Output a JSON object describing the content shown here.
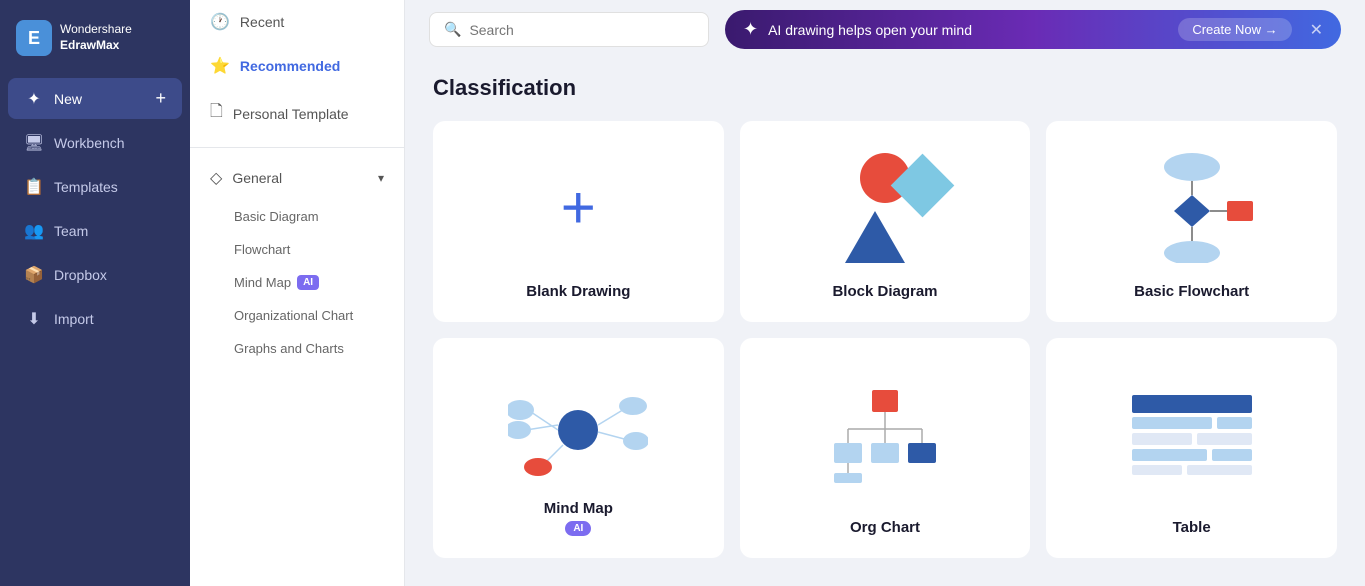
{
  "app": {
    "name": "Wondershare",
    "product": "EdrawMax"
  },
  "sidebar": {
    "items": [
      {
        "id": "new",
        "label": "New",
        "icon": "➕",
        "active": true
      },
      {
        "id": "workbench",
        "label": "Workbench",
        "icon": "🖥"
      },
      {
        "id": "templates",
        "label": "Templates",
        "icon": "📋"
      },
      {
        "id": "team",
        "label": "Team",
        "icon": "👥"
      },
      {
        "id": "dropbox",
        "label": "Dropbox",
        "icon": "📦"
      },
      {
        "id": "import",
        "label": "Import",
        "icon": "⬇"
      }
    ]
  },
  "nav": {
    "items": [
      {
        "id": "recent",
        "label": "Recent",
        "icon": "🕐"
      },
      {
        "id": "recommended",
        "label": "Recommended",
        "icon": "⭐",
        "active": true
      },
      {
        "id": "personal",
        "label": "Personal Template",
        "icon": "🖊"
      }
    ],
    "sections": [
      {
        "id": "general",
        "label": "General",
        "icon": "◇",
        "expanded": true,
        "sub": [
          {
            "id": "basic-diagram",
            "label": "Basic Diagram"
          },
          {
            "id": "flowchart",
            "label": "Flowchart"
          },
          {
            "id": "mind-map",
            "label": "Mind Map",
            "badge": "AI"
          },
          {
            "id": "org-chart",
            "label": "Organizational Chart"
          },
          {
            "id": "graphs",
            "label": "Graphs and Charts"
          }
        ]
      }
    ]
  },
  "topbar": {
    "search_placeholder": "Search",
    "ai_banner_text": "AI drawing helps open your mind",
    "ai_banner_btn": "Create Now →"
  },
  "main": {
    "section_title": "Classification",
    "cards": [
      {
        "id": "blank",
        "label": "Blank Drawing",
        "type": "blank"
      },
      {
        "id": "block",
        "label": "Block Diagram",
        "type": "block"
      },
      {
        "id": "flowchart",
        "label": "Basic Flowchart",
        "type": "flowchart"
      },
      {
        "id": "mindmap",
        "label": "Mind Map",
        "type": "mindmap",
        "ai": true
      },
      {
        "id": "orgchart",
        "label": "Org Chart",
        "type": "orgchart"
      },
      {
        "id": "table",
        "label": "Table",
        "type": "table"
      }
    ]
  }
}
